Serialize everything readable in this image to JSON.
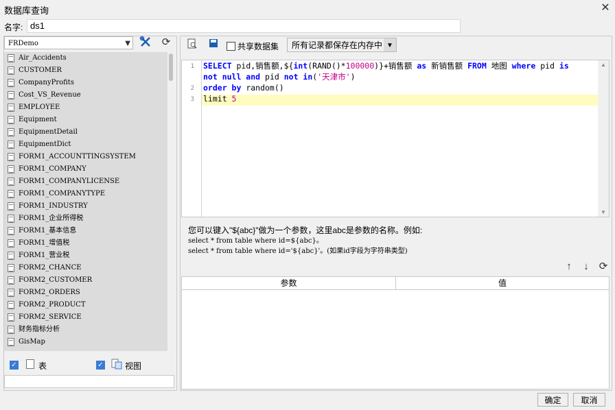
{
  "window": {
    "title": "数据库查询",
    "close_glyph": "✕"
  },
  "name_field": {
    "label": "名字:",
    "value": "ds1"
  },
  "datasource": {
    "selected": "FRDemo"
  },
  "tables": [
    "Air_Accidents",
    "CUSTOMER",
    "CompanyProfits",
    "Cost_VS_Revenue",
    "EMPLOYEE",
    "Equipment",
    "EquipmentDetail",
    "EquipmentDict",
    "FORM1_ACCOUNTTINGSYSTEM",
    "FORM1_COMPANY",
    "FORM1_COMPANYLICENSE",
    "FORM1_COMPANYTYPE",
    "FORM1_INDUSTRY",
    "FORM1_企业所得税",
    "FORM1_基本信息",
    "FORM1_增值税",
    "FORM1_营业税",
    "FORM2_CHANCE",
    "FORM2_CUSTOMER",
    "FORM2_ORDERS",
    "FORM2_PRODUCT",
    "FORM2_SERVICE",
    "财务指标分析",
    "GisMap"
  ],
  "filters": {
    "table_label": "表",
    "view_label": "视图"
  },
  "toolbar": {
    "share_label": "共享数据集",
    "storage_mode": "所有记录都保存在内存中"
  },
  "sql": {
    "line_numbers": [
      "1",
      "2",
      "3"
    ],
    "hint_line1": "您可以键入\"${abc}\"做为一个参数，这里abc是参数的名称。例如:",
    "hint_line2": "select * from table where id=${abc}。",
    "hint_line3": "select * from table where id='${abc}'。(如果id字段为字符串类型)"
  },
  "params": {
    "col_param": "参数",
    "col_value": "值"
  },
  "buttons": {
    "ok": "确定",
    "cancel": "取消"
  },
  "colors": {
    "keyword": "#0000ff",
    "string": "#c20088",
    "highlight": "#fffcc0",
    "checkbox": "#3a7bd5"
  }
}
